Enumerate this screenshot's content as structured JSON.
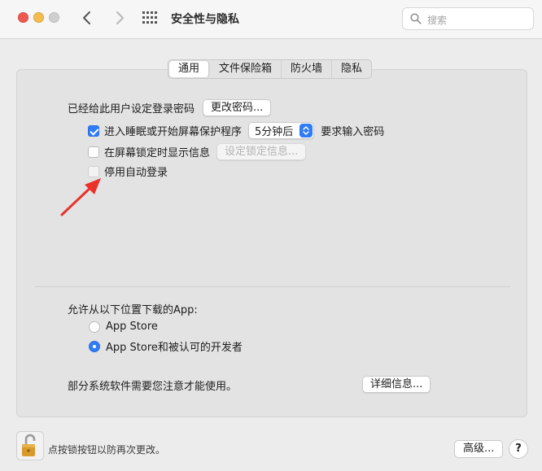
{
  "window": {
    "title": "安全性与隐私"
  },
  "search": {
    "placeholder": "搜索"
  },
  "tabs": [
    {
      "label": "通用",
      "active": true
    },
    {
      "label": "文件保险箱",
      "active": false
    },
    {
      "label": "防火墙",
      "active": false
    },
    {
      "label": "隐私",
      "active": false
    }
  ],
  "general": {
    "password_label": "已经给此用户设定登录密码",
    "change_password_button": "更改密码...",
    "require_password": {
      "checked": true,
      "label": "进入睡眠或开始屏幕保护程序",
      "select_value": "5分钟后",
      "suffix": "要求输入密码"
    },
    "show_message": {
      "checked": false,
      "label": "在屏幕锁定时显示信息",
      "button": "设定锁定信息..."
    },
    "disable_auto_login": {
      "checked": false,
      "label": "停用自动登录"
    },
    "download_heading": "允许从以下位置下载的App:",
    "download_options": [
      {
        "label": "App Store",
        "selected": false
      },
      {
        "label": "App Store和被认可的开发者",
        "selected": true
      }
    ],
    "attention_text": "部分系统软件需要您注意才能使用。",
    "details_button": "详细信息..."
  },
  "footer": {
    "lock_text": "点按锁按钮以防再次更改。",
    "advanced_button": "高级...",
    "help_button": "?"
  },
  "colors": {
    "accent": "#2f7cf6",
    "annotation_arrow": "#e8322a"
  }
}
